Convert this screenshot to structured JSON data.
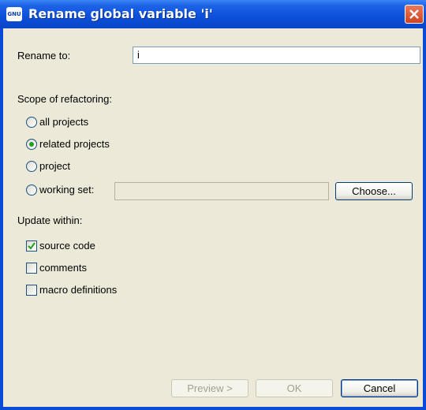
{
  "window": {
    "title": "Rename global variable 'i'",
    "app_icon_text": "GNU"
  },
  "form": {
    "rename_label": "Rename to:",
    "rename_value": "i",
    "scope_heading": "Scope of refactoring:",
    "scope_options": [
      "all projects",
      "related projects",
      "project",
      "working set:"
    ],
    "scope_selected": "related projects",
    "working_set_value": "",
    "choose_button": "Choose...",
    "update_heading": "Update within:",
    "update_options": [
      {
        "label": "source code",
        "checked": true
      },
      {
        "label": "comments",
        "checked": false
      },
      {
        "label": "macro definitions",
        "checked": false
      }
    ]
  },
  "buttons": {
    "preview": "Preview >",
    "ok": "OK",
    "cancel": "Cancel"
  }
}
